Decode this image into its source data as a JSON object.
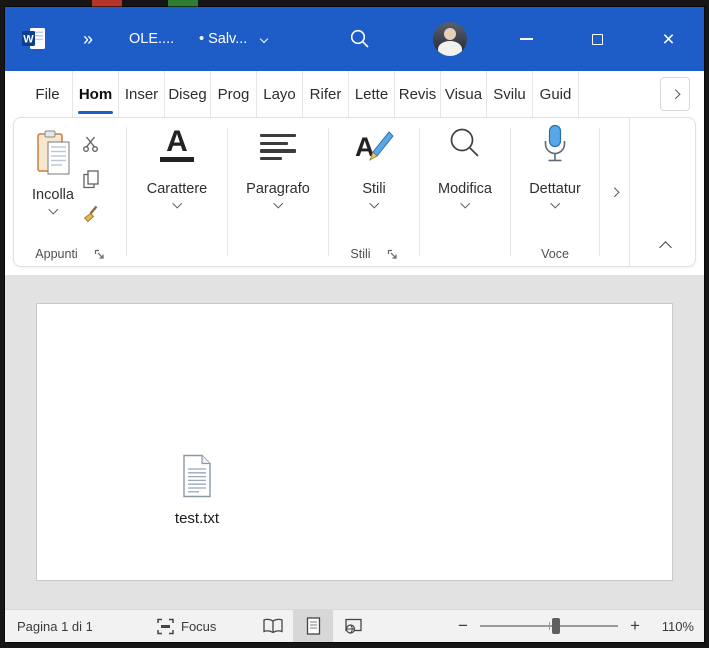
{
  "colors": {
    "accent": "#1e5cc8",
    "titlebar": "#1e5cc8",
    "mic": "#5aa7e8",
    "doc_area_bg": "#e2e2e2",
    "desktop_red": "#b5342a",
    "desktop_green": "#2e7d32"
  },
  "titlebar": {
    "app_letter": "W",
    "qat_overflow": "»",
    "doc_title": "OLE....",
    "save_status": "• Salv...",
    "close_glyph": "×"
  },
  "tabs": {
    "file": "File",
    "home": "Hom",
    "insert": "Inser",
    "draw": "Diseg",
    "design": "Prog",
    "layout": "Layo",
    "references": "Rifer",
    "mailings": "Lette",
    "review": "Revis",
    "view": "Visua",
    "developer": "Svilu",
    "help": "Guid"
  },
  "ribbon": {
    "paste_label": "Incolla",
    "font_label": "Carattere",
    "font_icon_letter": "A",
    "paragraph_label": "Paragrafo",
    "styles_label": "Stili",
    "styles_icon_letter": "A",
    "editing_label": "Modifica",
    "dictate_label": "Dettatur",
    "group_clipboard": "Appunti",
    "group_styles": "Stili",
    "group_voice": "Voce"
  },
  "document": {
    "embedded_file_name": "test.txt"
  },
  "statusbar": {
    "page_indicator": "Pagina 1 di 1",
    "focus_label": "Focus",
    "zoom_minus": "−",
    "zoom_plus": "+",
    "zoom_level": "110%"
  }
}
